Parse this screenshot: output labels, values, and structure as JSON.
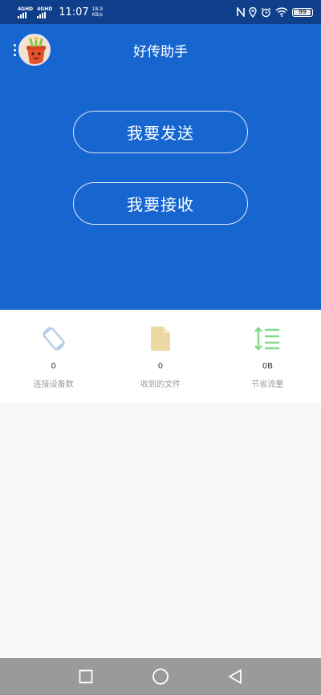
{
  "status_bar": {
    "sim1": "4GHD",
    "sim2": "4GHD",
    "time": "11:07",
    "speed_value": "18.9",
    "speed_unit": "KB/s",
    "battery": "99"
  },
  "header": {
    "title": "好传助手"
  },
  "actions": {
    "send_label": "我要发送",
    "receive_label": "我要接收"
  },
  "stats": [
    {
      "value": "0",
      "label": "连接设备数",
      "icon": "rotate-device-icon",
      "color": "#b7cde6"
    },
    {
      "value": "0",
      "label": "收到的文件",
      "icon": "file-icon",
      "color": "#ecd9a2"
    },
    {
      "value": "0B",
      "label": "节省流量",
      "icon": "traffic-icon",
      "color": "#7fda8a"
    }
  ],
  "colors": {
    "status_bar": "#0f3f8a",
    "hero": "#1766d0",
    "nav_bar": "#9a9a9a"
  },
  "nav": {
    "buttons": [
      "recent-apps-icon",
      "home-icon",
      "back-icon"
    ]
  }
}
